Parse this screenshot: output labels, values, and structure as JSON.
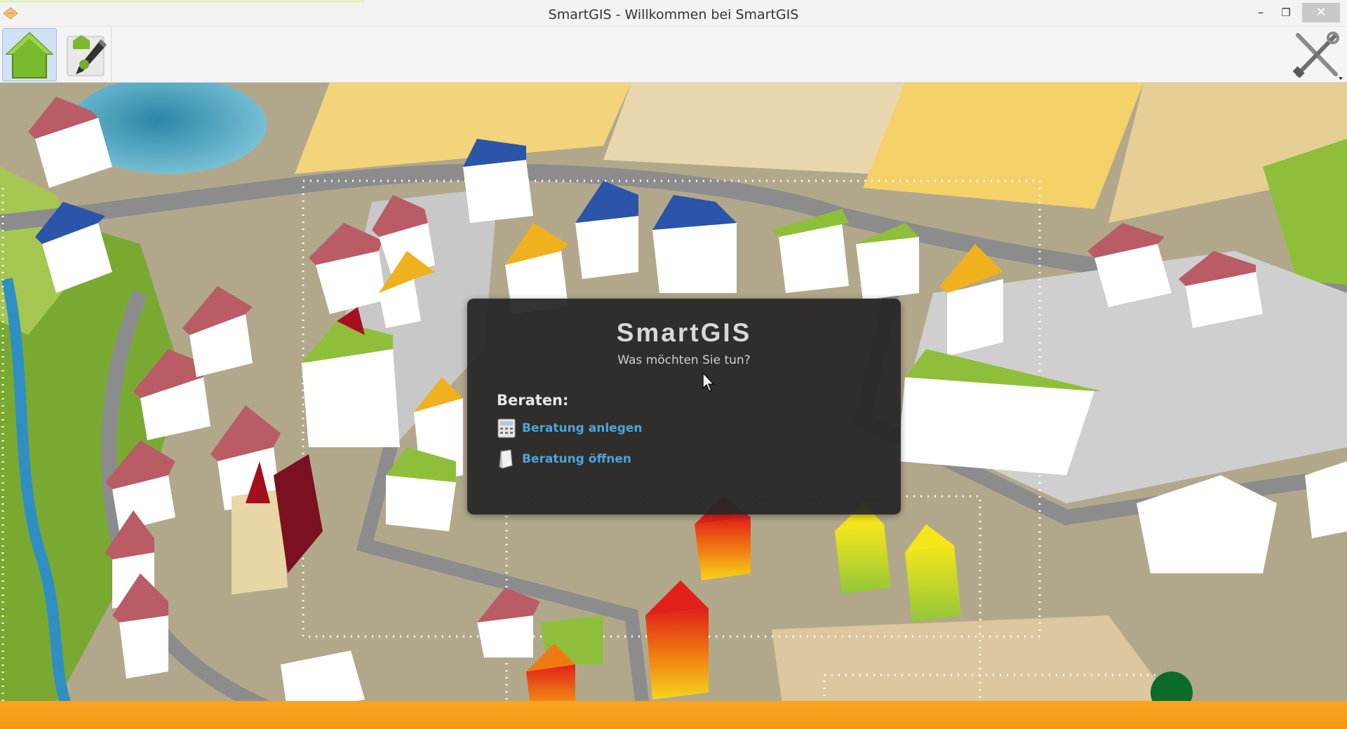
{
  "window": {
    "title": "SmartGIS - Willkommen bei SmartGIS",
    "controls": {
      "minimize": "–",
      "maximize": "❐",
      "close": "✕"
    }
  },
  "toolbar": {
    "buttons": [
      {
        "name": "home",
        "icon": "house-icon",
        "color": "#7ab82c"
      },
      {
        "name": "edit",
        "icon": "pen-edit-icon"
      },
      {
        "name": "settings",
        "icon": "tools-icon"
      }
    ]
  },
  "dialog": {
    "title": "SmartGIS",
    "subtitle": "Was möchten Sie tun?",
    "section": "Beraten:",
    "actions": [
      {
        "label": "Beratung anlegen",
        "icon": "calculator-document-icon"
      },
      {
        "label": "Beratung öffnen",
        "icon": "open-document-icon"
      }
    ],
    "link_color": "#4aa6d9"
  },
  "background": {
    "description_icon": "illustrated-town-map",
    "accent_color": "#f39a16"
  }
}
